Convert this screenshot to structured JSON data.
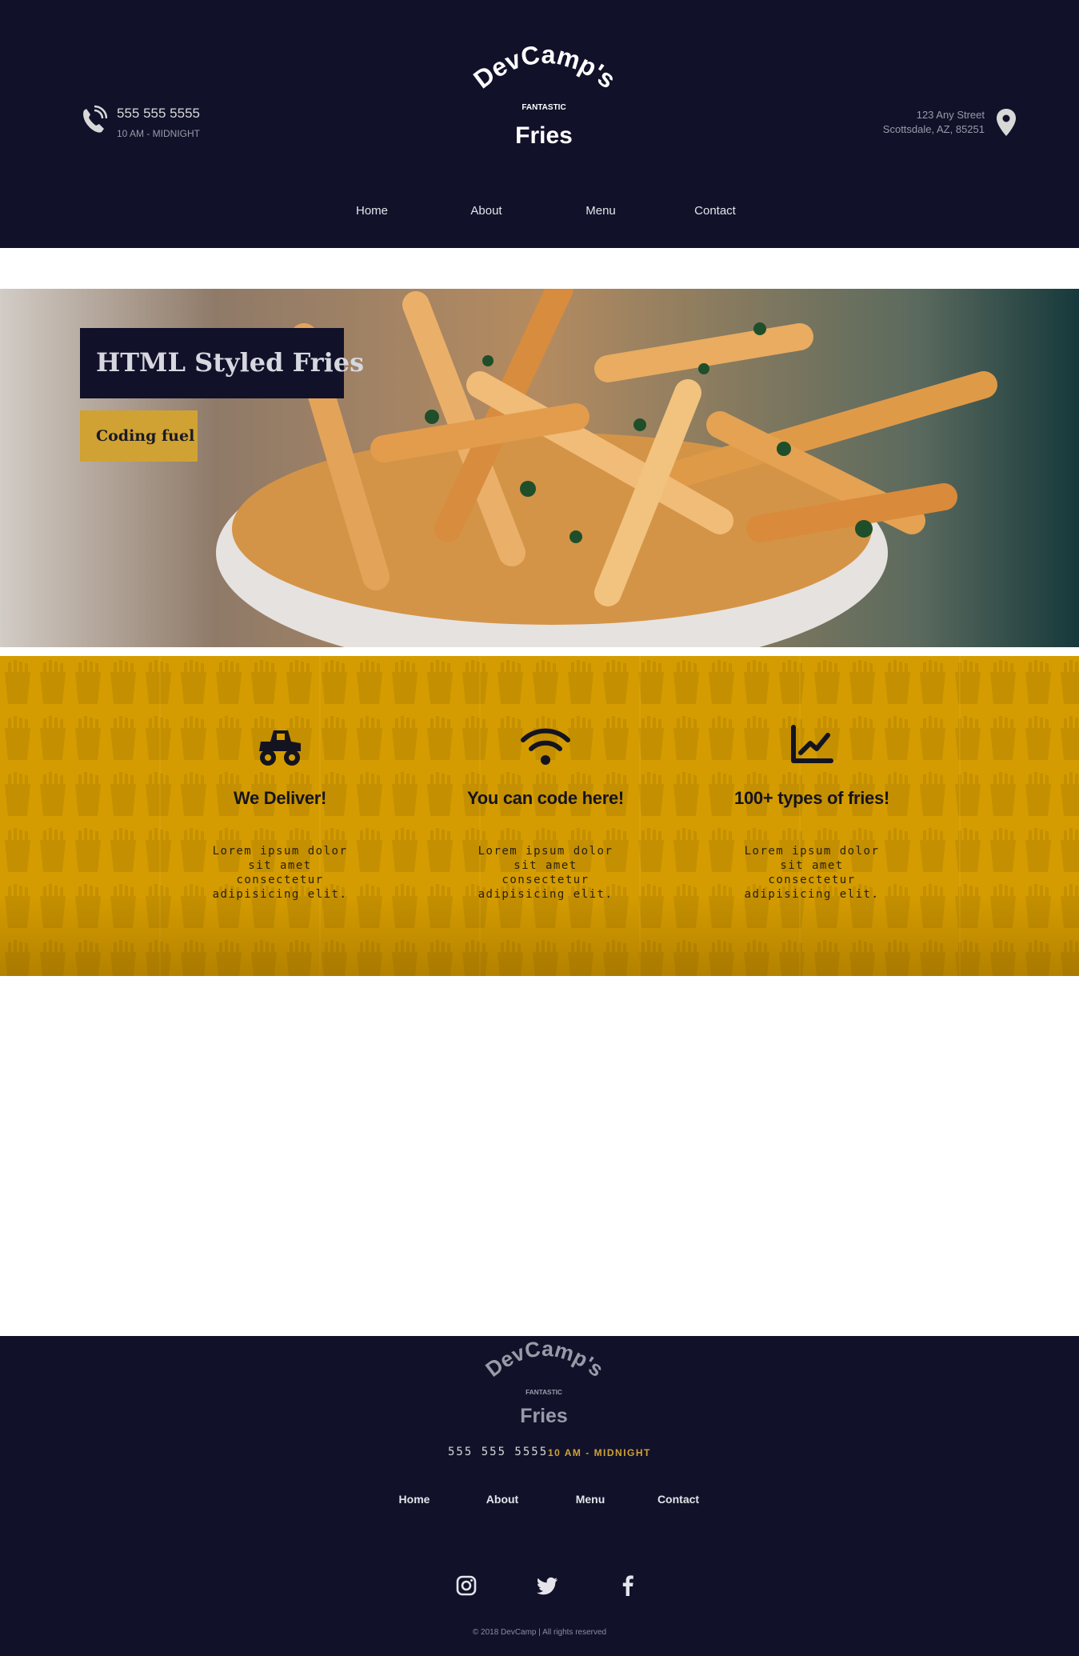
{
  "header": {
    "phone": "555 555 5555",
    "hours": "10 AM - MIDNIGHT",
    "address_line1": "123 Any Street",
    "address_line2": "Scottsdale, AZ, 85251",
    "logo": {
      "line1": "DevCamp's",
      "line2": "FANTASTIC",
      "line3": "Fries"
    },
    "nav": [
      "Home",
      "About",
      "Menu",
      "Contact"
    ]
  },
  "hero": {
    "title": "HTML Styled Fries",
    "subtitle": "Coding fuel"
  },
  "features": [
    {
      "icon": "monster-truck-icon",
      "title": "We Deliver!",
      "desc": "Lorem ipsum dolor sit amet consectetur adipisicing elit."
    },
    {
      "icon": "wifi-icon",
      "title": "You can code here!",
      "desc": "Lorem ipsum dolor sit amet consectetur adipisicing elit."
    },
    {
      "icon": "line-chart-icon",
      "title": "100+ types of fries!",
      "desc": "Lorem ipsum dolor sit amet consectetur adipisicing elit."
    }
  ],
  "footer": {
    "logo": {
      "line1": "DevCamp's",
      "line2": "FANTASTIC",
      "line3": "Fries"
    },
    "phone": "555 555 5555",
    "hours": "10 AM - MIDNIGHT",
    "nav": [
      "Home",
      "About",
      "Menu",
      "Contact"
    ],
    "social": [
      "instagram-icon",
      "twitter-icon",
      "facebook-icon"
    ],
    "copyright": "© 2018 DevCamp | All rights reserved"
  },
  "colors": {
    "navy": "#11112a",
    "gold": "#d0a233",
    "feature_bg": "#d49c00"
  }
}
